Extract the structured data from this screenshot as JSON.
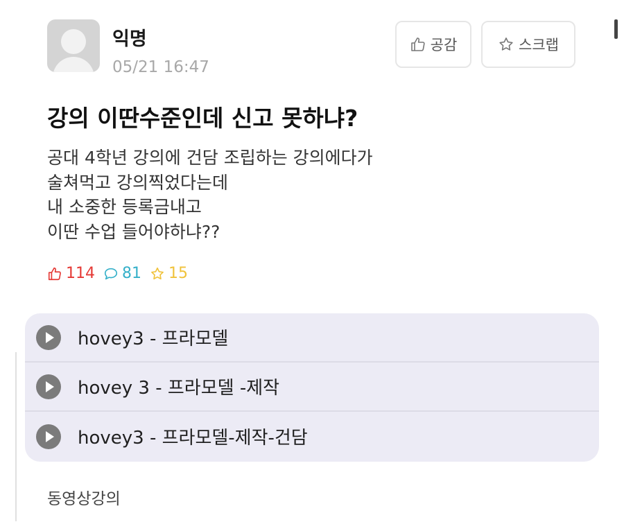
{
  "post": {
    "author": "익명",
    "timestamp": "05/21 16:47",
    "buttons": {
      "like_label": "공감",
      "like_icon": "thumbs-up-icon",
      "scrap_label": "스크랩",
      "scrap_icon": "star-icon"
    },
    "title": "강의 이딴수준인데 신고 못하냐?",
    "body_lines": [
      "공대 4학년 강의에 건담 조립하는 강의에다가",
      "술쳐먹고 강의찍었다는데",
      "내 소중한 등록금내고",
      "이딴 수업 들어야하냐??"
    ],
    "stats": {
      "likes": "114",
      "comments": "81",
      "scraps": "15",
      "colors": {
        "likes": "#e53935",
        "comments": "#35b0c9",
        "scraps": "#f0c23a"
      }
    },
    "media_items": [
      {
        "label": "hovey3 - 프라모델",
        "icon": "play-icon"
      },
      {
        "label": "hovey 3 - 프라모델 -제작",
        "icon": "play-icon"
      },
      {
        "label": "hovey3 - 프라모델-제작-건담",
        "icon": "play-icon"
      }
    ],
    "caption": "동영상강의"
  }
}
